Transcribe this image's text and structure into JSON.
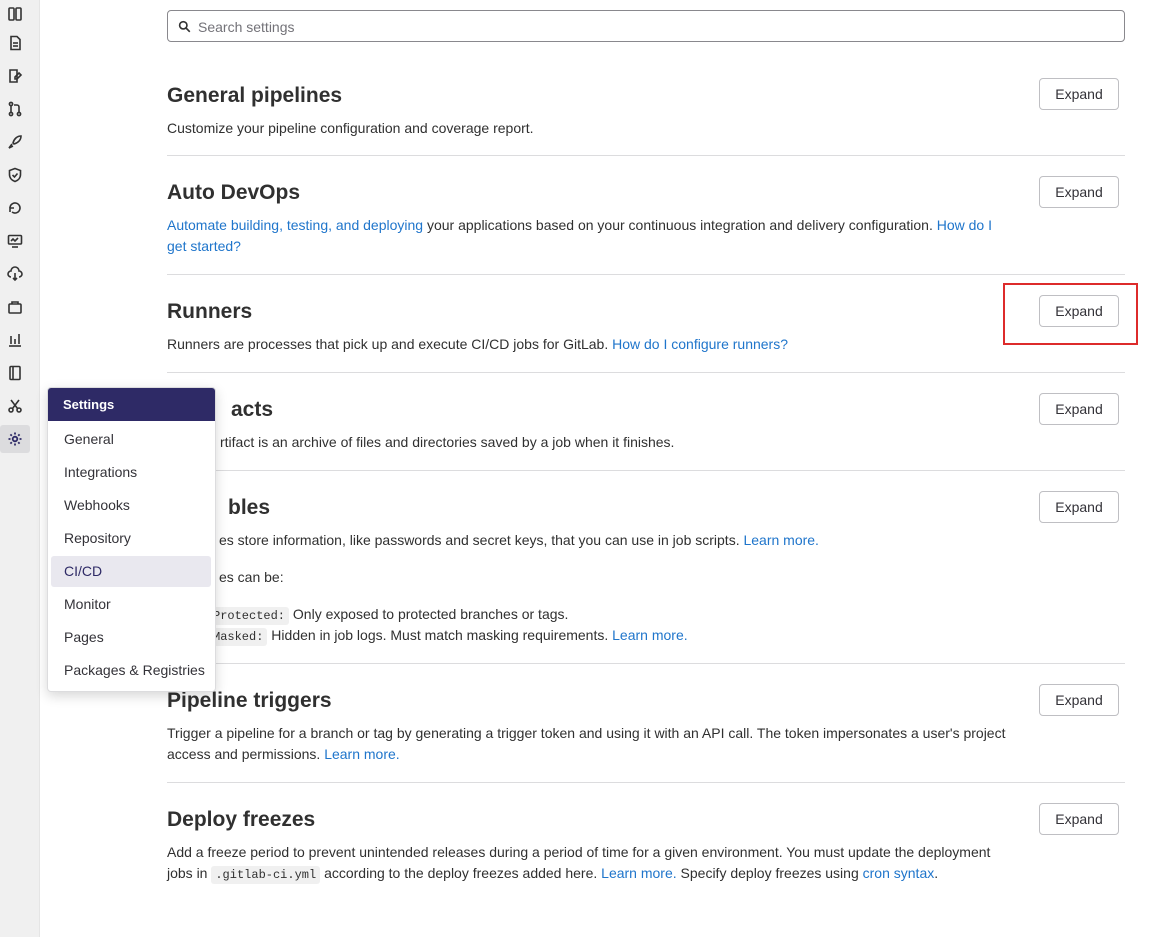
{
  "search": {
    "placeholder": "Search settings",
    "value": ""
  },
  "rail": {
    "icons": [
      "project-icon",
      "issues-icon",
      "merge-requests-icon",
      "repository-icon",
      "deployments-icon",
      "security-icon",
      "environments-icon",
      "monitor-icon",
      "infrastructure-icon",
      "packages-icon",
      "analytics-icon",
      "wiki-icon",
      "snippets-icon",
      "settings-icon"
    ]
  },
  "flyout": {
    "title": "Settings",
    "items": [
      "General",
      "Integrations",
      "Webhooks",
      "Repository",
      "CI/CD",
      "Monitor",
      "Pages",
      "Packages & Registries"
    ],
    "active": "CI/CD"
  },
  "sections": {
    "general_pipelines": {
      "title": "General pipelines",
      "desc": "Customize your pipeline configuration and coverage report.",
      "button": "Expand"
    },
    "auto_devops": {
      "title": "Auto DevOps",
      "link1": "Automate building, testing, and deploying",
      "desc": " your applications based on your continuous integration and delivery configuration. ",
      "link2": "How do I get started?",
      "button": "Expand"
    },
    "runners": {
      "title": "Runners",
      "desc": "Runners are processes that pick up and execute CI/CD jobs for GitLab. ",
      "link": "How do I configure runners?",
      "button": "Expand"
    },
    "artifacts": {
      "title": "acts",
      "desc": "rtifact is an archive of files and directories saved by a job when it finishes.",
      "button": "Expand"
    },
    "variables": {
      "title": "bles",
      "desc": "es store information, like passwords and secret keys, that you can use in job scripts. ",
      "link": "Learn more.",
      "can_be": "es can be:",
      "protected_code": "Protected:",
      "protected_text": " Only exposed to protected branches or tags.",
      "masked_code": "Masked:",
      "masked_text": " Hidden in job logs. Must match masking requirements. ",
      "masked_link": "Learn more.",
      "button": "Expand"
    },
    "pipeline_triggers": {
      "title": "Pipeline triggers",
      "desc": "Trigger a pipeline for a branch or tag by generating a trigger token and using it with an API call. The token impersonates a user's project access and permissions. ",
      "link": "Learn more.",
      "button": "Expand"
    },
    "deploy_freezes": {
      "title": "Deploy freezes",
      "desc1": "Add a freeze period to prevent unintended releases during a period of time for a given environment. You must update the deployment jobs in ",
      "code": ".gitlab-ci.yml",
      "desc2": " according to the deploy freezes added here. ",
      "link1": "Learn more.",
      "desc3": " Specify deploy freezes using ",
      "link2": "cron syntax",
      "desc4": ".",
      "button": "Expand"
    }
  },
  "colors": {
    "accent": "#2e2a66",
    "link": "#1f75cb",
    "highlight": "#dd2b2b"
  }
}
